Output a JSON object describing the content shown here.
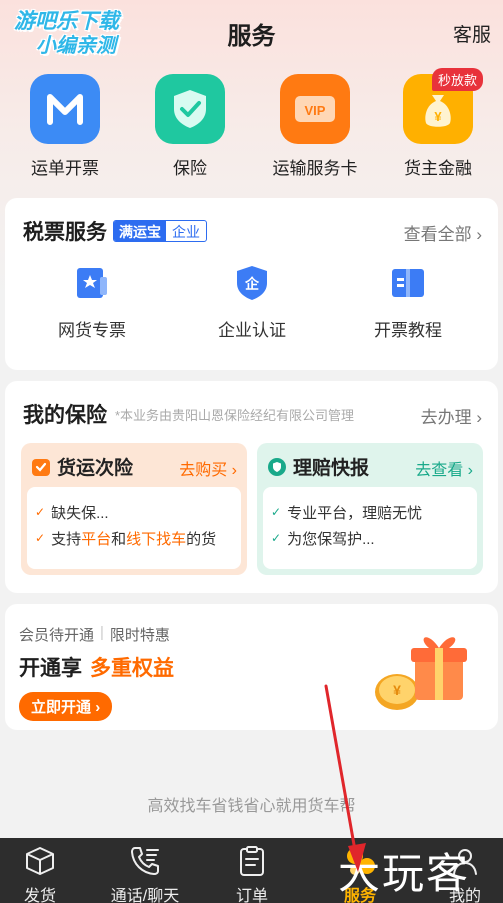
{
  "header": {
    "watermark_line1": "游吧乐下载",
    "watermark_line2": "小编亲测",
    "title": "服务",
    "customer_service": "客服"
  },
  "quick_actions": [
    {
      "label": "运单开票",
      "icon": "m-letter-icon",
      "color": "#3c8bf5"
    },
    {
      "label": "保险",
      "icon": "shield-check-icon",
      "color": "#1fc8a0"
    },
    {
      "label": "运输服务卡",
      "icon": "vip-card-icon",
      "color": "#ff7a12"
    },
    {
      "label": "货主金融",
      "icon": "money-bag-icon",
      "color": "#ffb000",
      "badge": "秒放款"
    }
  ],
  "tax_card": {
    "title": "税票服务",
    "badge_a": "满运宝",
    "badge_b": "企业",
    "more": "查看全部",
    "items": [
      {
        "label": "网货专票",
        "icon": "star-ticket-icon"
      },
      {
        "label": "企业认证",
        "icon": "enterprise-shield-icon"
      },
      {
        "label": "开票教程",
        "icon": "book-icon"
      }
    ]
  },
  "insurance_card": {
    "title": "我的保险",
    "note": "*本业务由贵阳山恩保险经纪有限公司管理",
    "more": "去办理",
    "freight": {
      "title": "货运次险",
      "link": "去购买",
      "line1": "缺失保...",
      "line2_a": "支持",
      "line2_b": "平台",
      "line2_c": "和",
      "line2_d": "线下找车",
      "line2_e": "的货"
    },
    "claims": {
      "title": "理赔快报",
      "link": "去查看",
      "line1": "专业平台，理赔无忧",
      "line2": "为您保驾护..."
    }
  },
  "promo": {
    "status": "会员待开通",
    "tag": "限时特惠",
    "headline_a": "开通享",
    "headline_b": "多重权益",
    "button": "立即开通"
  },
  "slogan": "高效找车省钱省心就用货车帮",
  "tabs": [
    {
      "label": "发货",
      "icon": "box-icon"
    },
    {
      "label": "通话/聊天",
      "icon": "phone-chat-icon"
    },
    {
      "label": "订单",
      "icon": "clipboard-icon"
    },
    {
      "label": "服务",
      "icon": "service-icon",
      "active": true
    },
    {
      "label": "我的",
      "icon": "user-icon"
    }
  ],
  "watermark_bottom": "大玩客",
  "colors": {
    "accent_orange": "#ff6a00",
    "accent_blue": "#2d6cf0",
    "active_tab": "#ffb400",
    "teal": "#19a98a",
    "annotation_arrow": "#e0262b"
  }
}
